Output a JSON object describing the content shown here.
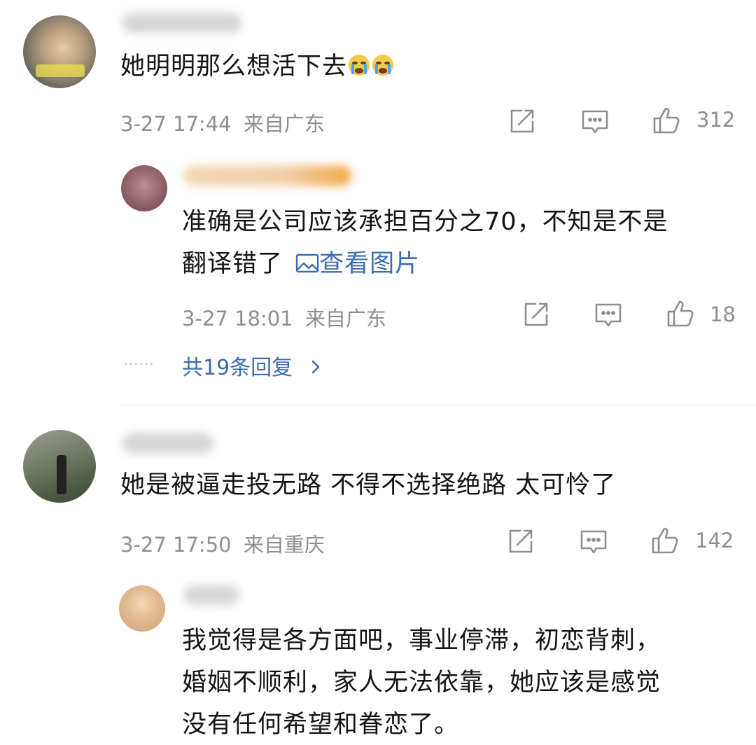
{
  "comments": [
    {
      "text": "她明明那么想活下去",
      "emoji": [
        "crying-face",
        "crying-face"
      ],
      "time": "3-27 17:44",
      "location": "来自广东",
      "likes": "312",
      "reply": {
        "text_line1": "准确是公司应该承担百分之70，不知是不是",
        "text_line2": "翻译错了",
        "view_image": "查看图片",
        "time": "3-27 18:01",
        "location": "来自广东",
        "likes": "18"
      },
      "more_dots": "……",
      "more_replies": "共19条回复"
    },
    {
      "text": "她是被逼走投无路 不得不选择绝路 太可怜了",
      "time": "3-27 17:50",
      "location": "来自重庆",
      "likes": "142",
      "reply": {
        "text_line1": "我觉得是各方面吧，事业停滞，初恋背刺，",
        "text_line2": "婚姻不顺利，家人无法依靠，她应该是感觉",
        "text_line3": "没有任何希望和眷恋了。"
      }
    }
  ],
  "icons": {
    "share": "share-icon",
    "comment": "comment-icon",
    "like": "thumbs-up-icon",
    "chevron": "chevron-right-icon",
    "image": "image-icon"
  },
  "colors": {
    "link": "#3b6cb0",
    "meta": "#8e8e8e",
    "text": "#141414"
  }
}
